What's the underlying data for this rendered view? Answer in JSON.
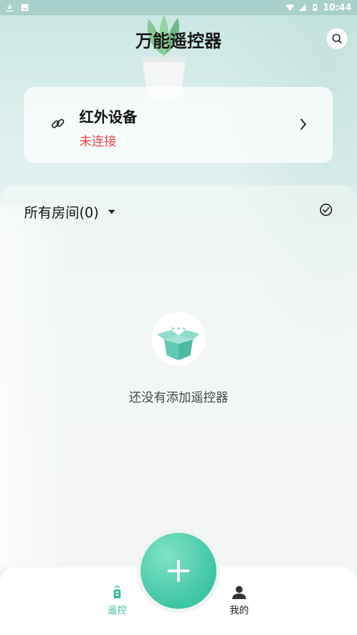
{
  "status_bar": {
    "time": "10:44"
  },
  "header": {
    "title": "万能遥控器",
    "search_icon": "search-icon"
  },
  "device_card": {
    "name": "红外设备",
    "status": "未连接",
    "status_color": "#e5484d"
  },
  "rooms": {
    "selector_label": "所有房间(0)"
  },
  "empty_state": {
    "message": "还没有添加遥控器"
  },
  "bottom_nav": {
    "items": [
      {
        "label": "遥控",
        "icon": "remote-icon",
        "active": true
      },
      {
        "label": "我的",
        "icon": "person-icon",
        "active": false
      }
    ],
    "add_icon": "plus-icon"
  },
  "colors": {
    "accent": "#3fc0a1",
    "alert": "#e5484d"
  }
}
